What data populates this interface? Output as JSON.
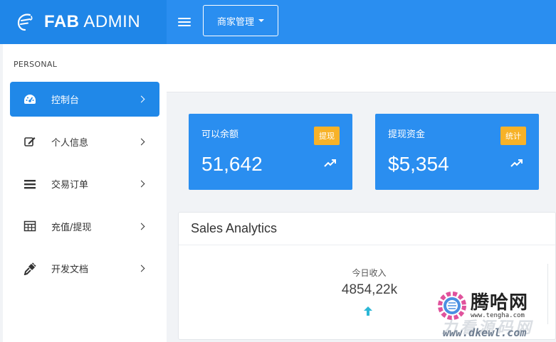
{
  "brand": {
    "bold": "FAB",
    "light": "ADMIN",
    "logo_icon": "stylized-f-logo"
  },
  "topbar": {
    "menu_icon": "hamburger-icon",
    "merchant_label": "商家管理"
  },
  "sidebar": {
    "section": "PERSONAL",
    "items": [
      {
        "label": "控制台",
        "icon": "dashboard-icon",
        "active": true
      },
      {
        "label": "个人信息",
        "icon": "edit-icon",
        "active": false
      },
      {
        "label": "交易订单",
        "icon": "list-icon",
        "active": false
      },
      {
        "label": "充值/提现",
        "icon": "table-icon",
        "active": false
      },
      {
        "label": "开发文档",
        "icon": "plug-icon",
        "active": false
      }
    ]
  },
  "cards": [
    {
      "title": "可以余额",
      "badge": "提现",
      "value": "51,642"
    },
    {
      "title": "提现资金",
      "badge": "统计",
      "value": "$5,354"
    }
  ],
  "analytics": {
    "title": "Sales Analytics",
    "today_label": "今日收入",
    "today_value": "4854,22k"
  },
  "watermark": {
    "title": "腾哈网",
    "url_small": "www.tengha.com",
    "big_text": "力看源码网",
    "url_big": "www.dkewl.com"
  },
  "colors": {
    "primary": "#2a8ef0",
    "badge": "#f7b228",
    "accent_arrow": "#2bb7d6"
  }
}
